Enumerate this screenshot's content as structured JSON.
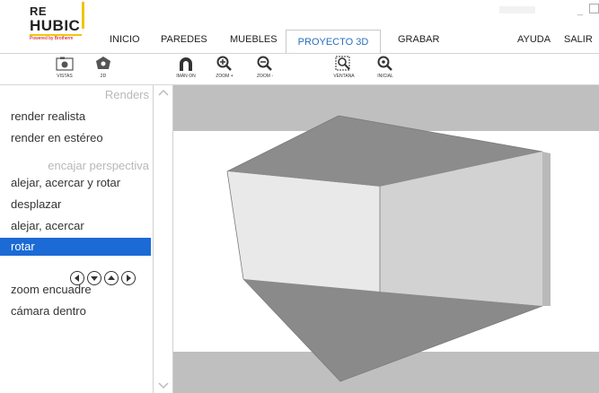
{
  "logo": {
    "line1": "RE",
    "line2": "HUBIC",
    "powered": "Powered by Brotherm"
  },
  "menu": [
    {
      "label": "INICIO"
    },
    {
      "label": "PAREDES"
    },
    {
      "label": "MUEBLES"
    },
    {
      "label": "PROYECTO 3D"
    },
    {
      "label": "GRABAR"
    },
    {
      "label": "AYUDA"
    },
    {
      "label": "SALIR"
    }
  ],
  "window_controls": {
    "minimize": "_"
  },
  "toolbar": [
    {
      "label": "VISTAS",
      "icon": "camera-icon"
    },
    {
      "label": "2D",
      "icon": "compass-icon"
    },
    {
      "label": "IMÁN ON",
      "icon": "magnet-icon"
    },
    {
      "label": "ZOOM +",
      "icon": "zoom-in-icon"
    },
    {
      "label": "ZOOM -",
      "icon": "zoom-out-icon"
    },
    {
      "label": "VENTANA",
      "icon": "zoom-window-icon"
    },
    {
      "label": "INICIAL",
      "icon": "zoom-initial-icon"
    }
  ],
  "panel": {
    "renders_title": "Renders",
    "render_items": [
      "render realista",
      "render en estéreo"
    ],
    "perspective_title": "encajar perspectiva",
    "perspective_items": [
      "alejar, acercar y rotar",
      "desplazar",
      "alejar, acercar",
      "rotar"
    ],
    "selected": "rotar",
    "after_items": [
      "zoom encuadre",
      "cámara dentro"
    ],
    "nav_arrows": [
      "left-arrow-icon",
      "down-arrow-icon",
      "up-arrow-icon",
      "right-arrow-icon"
    ]
  },
  "colors": {
    "accent": "#1b6ad6",
    "active_tab_text": "#2a6fbd",
    "logo_yellow": "#f1c40f"
  }
}
